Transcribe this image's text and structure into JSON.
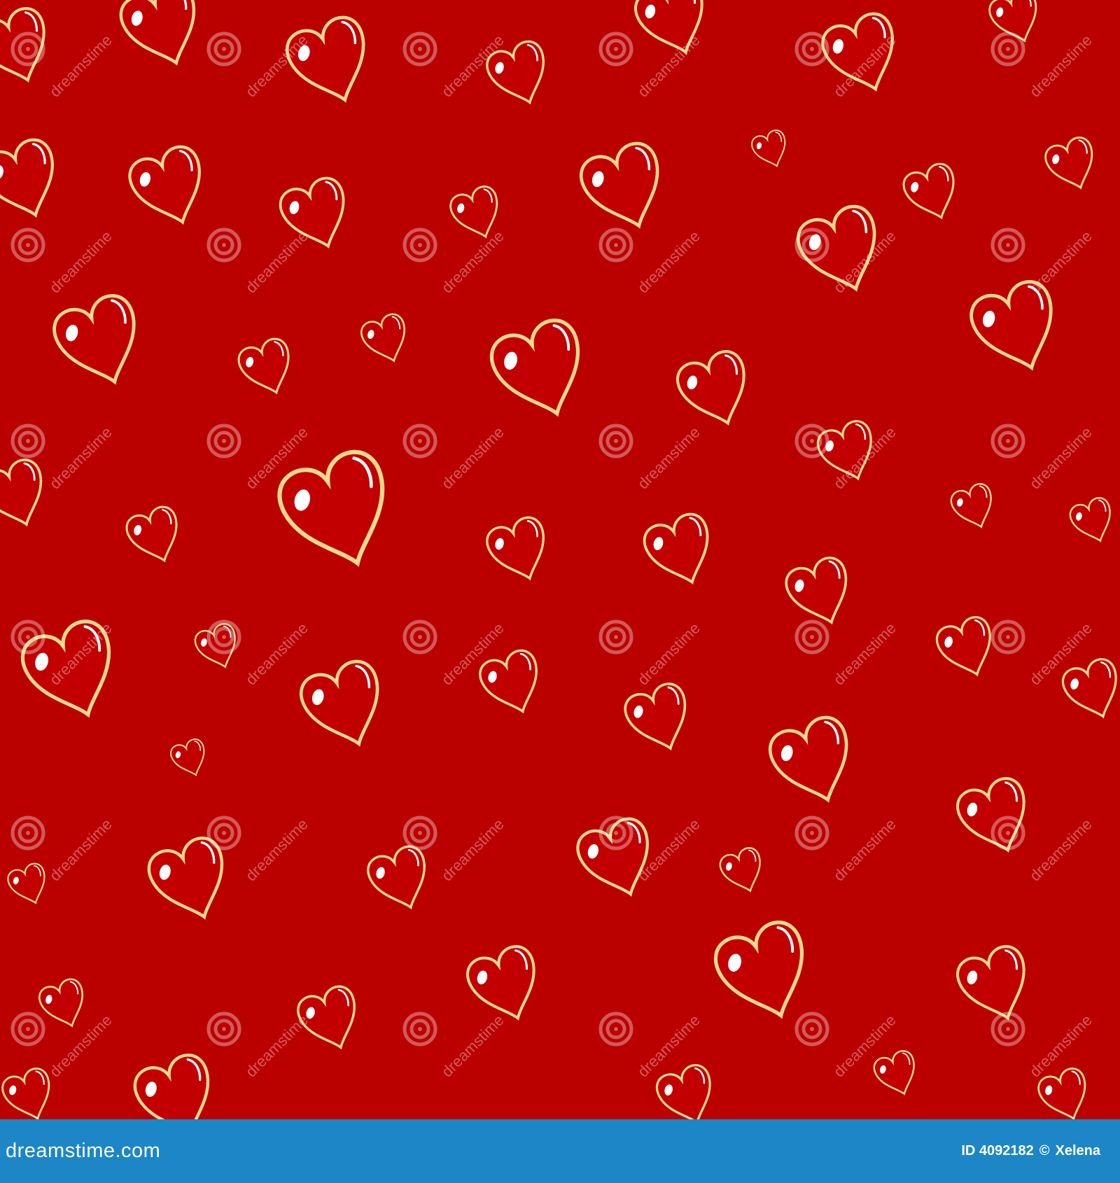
{
  "background_color": "#bb0000",
  "heart_fill_color": "#c20002",
  "heart_outline_color": "#f5d98e",
  "highlight_color": "#ffffff",
  "watermark_color": "#ffffff",
  "watermark_text": "dreamstime",
  "footer": {
    "bar_color": "#1c86c7",
    "site": "dreamstime.com",
    "id_label": "ID 4092182",
    "separator": "©",
    "author": "Xelena"
  }
}
